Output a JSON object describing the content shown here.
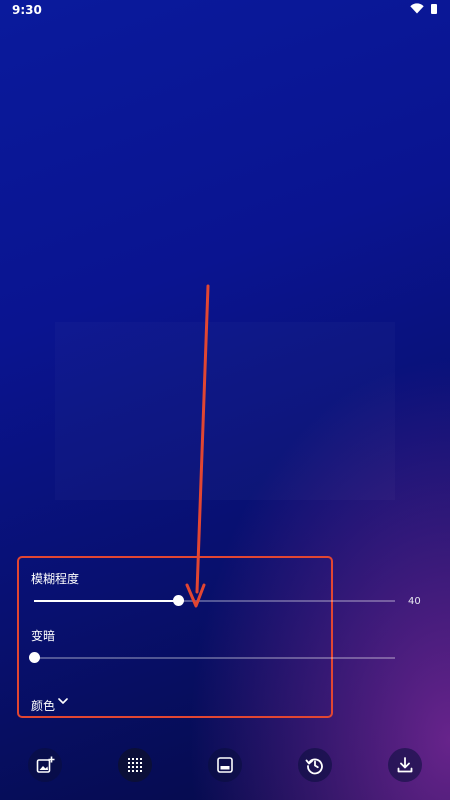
{
  "status_bar": {
    "time": "9:30"
  },
  "blur_panel": {
    "blur_label": "模糊程度",
    "blur_value": "40",
    "blur_fraction": 0.4,
    "dim_label": "变暗",
    "dim_fraction": 0.0,
    "color_label": "颜色"
  },
  "toolbar": {
    "items": [
      {
        "icon": "add-image-icon"
      },
      {
        "icon": "grid-dots-icon",
        "active": true
      },
      {
        "icon": "wallpaper-icon"
      },
      {
        "icon": "history-icon"
      },
      {
        "icon": "download-icon"
      }
    ]
  },
  "colors": {
    "accent_annotation": "#e24632",
    "slider_active": "#ffffff"
  }
}
